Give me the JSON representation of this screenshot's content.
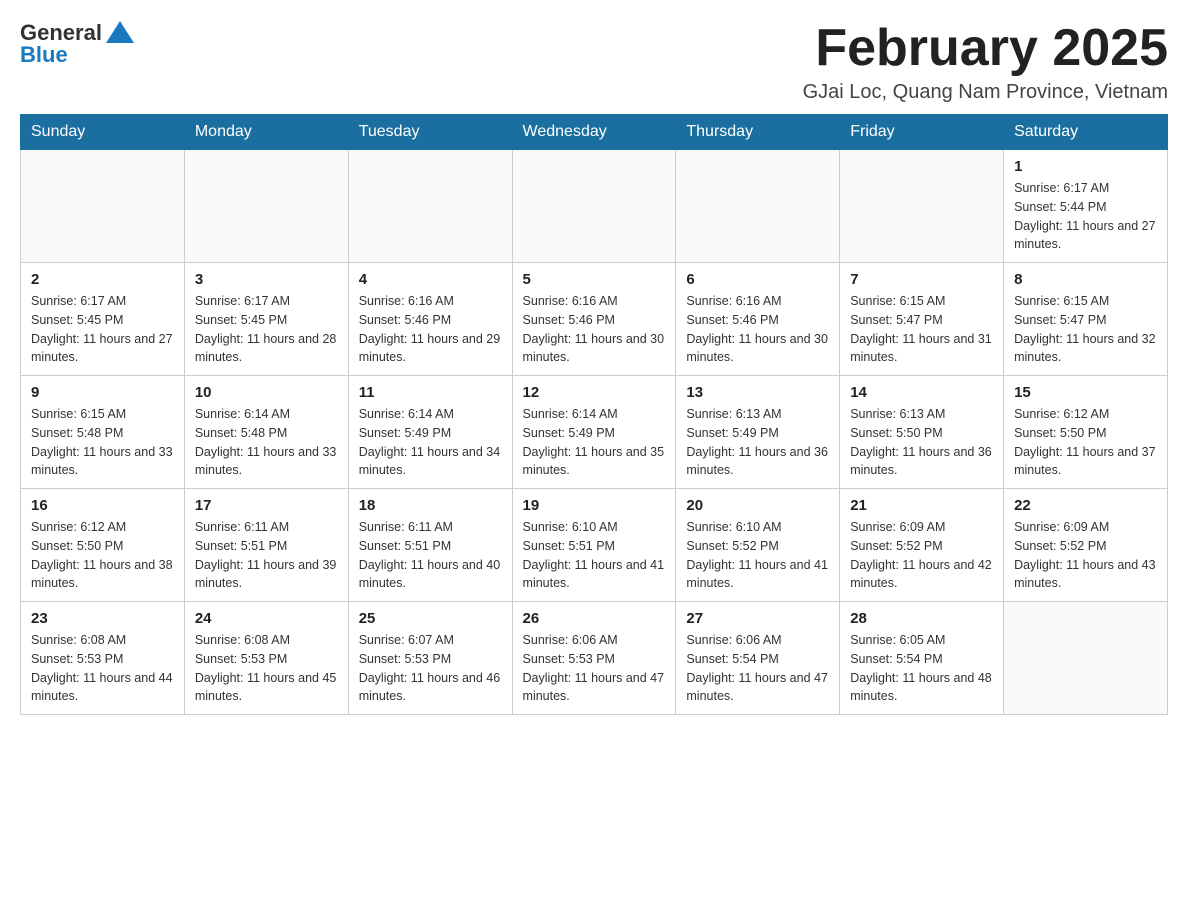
{
  "header": {
    "title": "February 2025",
    "location": "GJai Loc, Quang Nam Province, Vietnam",
    "logo_general": "General",
    "logo_blue": "Blue"
  },
  "days_of_week": [
    "Sunday",
    "Monday",
    "Tuesday",
    "Wednesday",
    "Thursday",
    "Friday",
    "Saturday"
  ],
  "weeks": [
    [
      {
        "day": "",
        "info": ""
      },
      {
        "day": "",
        "info": ""
      },
      {
        "day": "",
        "info": ""
      },
      {
        "day": "",
        "info": ""
      },
      {
        "day": "",
        "info": ""
      },
      {
        "day": "",
        "info": ""
      },
      {
        "day": "1",
        "info": "Sunrise: 6:17 AM\nSunset: 5:44 PM\nDaylight: 11 hours and 27 minutes."
      }
    ],
    [
      {
        "day": "2",
        "info": "Sunrise: 6:17 AM\nSunset: 5:45 PM\nDaylight: 11 hours and 27 minutes."
      },
      {
        "day": "3",
        "info": "Sunrise: 6:17 AM\nSunset: 5:45 PM\nDaylight: 11 hours and 28 minutes."
      },
      {
        "day": "4",
        "info": "Sunrise: 6:16 AM\nSunset: 5:46 PM\nDaylight: 11 hours and 29 minutes."
      },
      {
        "day": "5",
        "info": "Sunrise: 6:16 AM\nSunset: 5:46 PM\nDaylight: 11 hours and 30 minutes."
      },
      {
        "day": "6",
        "info": "Sunrise: 6:16 AM\nSunset: 5:46 PM\nDaylight: 11 hours and 30 minutes."
      },
      {
        "day": "7",
        "info": "Sunrise: 6:15 AM\nSunset: 5:47 PM\nDaylight: 11 hours and 31 minutes."
      },
      {
        "day": "8",
        "info": "Sunrise: 6:15 AM\nSunset: 5:47 PM\nDaylight: 11 hours and 32 minutes."
      }
    ],
    [
      {
        "day": "9",
        "info": "Sunrise: 6:15 AM\nSunset: 5:48 PM\nDaylight: 11 hours and 33 minutes."
      },
      {
        "day": "10",
        "info": "Sunrise: 6:14 AM\nSunset: 5:48 PM\nDaylight: 11 hours and 33 minutes."
      },
      {
        "day": "11",
        "info": "Sunrise: 6:14 AM\nSunset: 5:49 PM\nDaylight: 11 hours and 34 minutes."
      },
      {
        "day": "12",
        "info": "Sunrise: 6:14 AM\nSunset: 5:49 PM\nDaylight: 11 hours and 35 minutes."
      },
      {
        "day": "13",
        "info": "Sunrise: 6:13 AM\nSunset: 5:49 PM\nDaylight: 11 hours and 36 minutes."
      },
      {
        "day": "14",
        "info": "Sunrise: 6:13 AM\nSunset: 5:50 PM\nDaylight: 11 hours and 36 minutes."
      },
      {
        "day": "15",
        "info": "Sunrise: 6:12 AM\nSunset: 5:50 PM\nDaylight: 11 hours and 37 minutes."
      }
    ],
    [
      {
        "day": "16",
        "info": "Sunrise: 6:12 AM\nSunset: 5:50 PM\nDaylight: 11 hours and 38 minutes."
      },
      {
        "day": "17",
        "info": "Sunrise: 6:11 AM\nSunset: 5:51 PM\nDaylight: 11 hours and 39 minutes."
      },
      {
        "day": "18",
        "info": "Sunrise: 6:11 AM\nSunset: 5:51 PM\nDaylight: 11 hours and 40 minutes."
      },
      {
        "day": "19",
        "info": "Sunrise: 6:10 AM\nSunset: 5:51 PM\nDaylight: 11 hours and 41 minutes."
      },
      {
        "day": "20",
        "info": "Sunrise: 6:10 AM\nSunset: 5:52 PM\nDaylight: 11 hours and 41 minutes."
      },
      {
        "day": "21",
        "info": "Sunrise: 6:09 AM\nSunset: 5:52 PM\nDaylight: 11 hours and 42 minutes."
      },
      {
        "day": "22",
        "info": "Sunrise: 6:09 AM\nSunset: 5:52 PM\nDaylight: 11 hours and 43 minutes."
      }
    ],
    [
      {
        "day": "23",
        "info": "Sunrise: 6:08 AM\nSunset: 5:53 PM\nDaylight: 11 hours and 44 minutes."
      },
      {
        "day": "24",
        "info": "Sunrise: 6:08 AM\nSunset: 5:53 PM\nDaylight: 11 hours and 45 minutes."
      },
      {
        "day": "25",
        "info": "Sunrise: 6:07 AM\nSunset: 5:53 PM\nDaylight: 11 hours and 46 minutes."
      },
      {
        "day": "26",
        "info": "Sunrise: 6:06 AM\nSunset: 5:53 PM\nDaylight: 11 hours and 47 minutes."
      },
      {
        "day": "27",
        "info": "Sunrise: 6:06 AM\nSunset: 5:54 PM\nDaylight: 11 hours and 47 minutes."
      },
      {
        "day": "28",
        "info": "Sunrise: 6:05 AM\nSunset: 5:54 PM\nDaylight: 11 hours and 48 minutes."
      },
      {
        "day": "",
        "info": ""
      }
    ]
  ]
}
